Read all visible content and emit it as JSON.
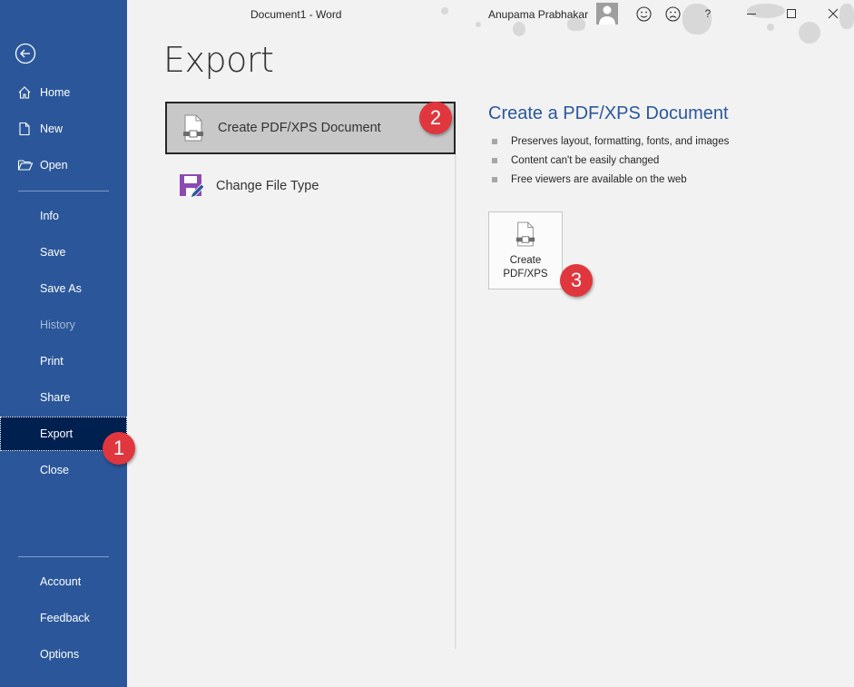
{
  "window": {
    "title": "Document1  -  Word",
    "user_name": "Anupama Prabhakar",
    "buttons": {
      "smile": "smile-icon",
      "frown": "frown-icon",
      "help": "?",
      "minimize": "minimize-icon",
      "maximize": "maximize-icon",
      "close": "close-icon"
    }
  },
  "sidebar": {
    "back_icon": "back-arrow-icon",
    "top_items": [
      {
        "label": "Home",
        "icon": "home-icon"
      },
      {
        "label": "New",
        "icon": "new-document-icon"
      },
      {
        "label": "Open",
        "icon": "open-folder-icon"
      }
    ],
    "middle_items": [
      {
        "label": "Info",
        "state": "normal"
      },
      {
        "label": "Save",
        "state": "normal"
      },
      {
        "label": "Save As",
        "state": "normal"
      },
      {
        "label": "History",
        "state": "disabled"
      },
      {
        "label": "Print",
        "state": "normal"
      },
      {
        "label": "Share",
        "state": "normal"
      },
      {
        "label": "Export",
        "state": "active"
      },
      {
        "label": "Close",
        "state": "normal"
      }
    ],
    "bottom_items": [
      {
        "label": "Account"
      },
      {
        "label": "Feedback"
      },
      {
        "label": "Options"
      }
    ]
  },
  "main": {
    "title": "Export",
    "options": [
      {
        "label": "Create PDF/XPS Document",
        "icon": "pdf-document-icon",
        "selected": true
      },
      {
        "label": "Change File Type",
        "icon": "save-as-filetype-icon",
        "selected": false
      }
    ],
    "detail": {
      "title": "Create a PDF/XPS Document",
      "bullets": [
        "Preserves layout, formatting, fonts, and images",
        "Content can't be easily changed",
        "Free viewers are available on the web"
      ],
      "button_line1": "Create",
      "button_line2": "PDF/XPS"
    }
  },
  "annotations": {
    "step1": "1",
    "step2": "2",
    "step3": "3"
  },
  "colors": {
    "sidebar": "#2b579a",
    "sidebar_active": "#002050",
    "accent_title": "#2b579a",
    "badge": "#e0363d"
  }
}
